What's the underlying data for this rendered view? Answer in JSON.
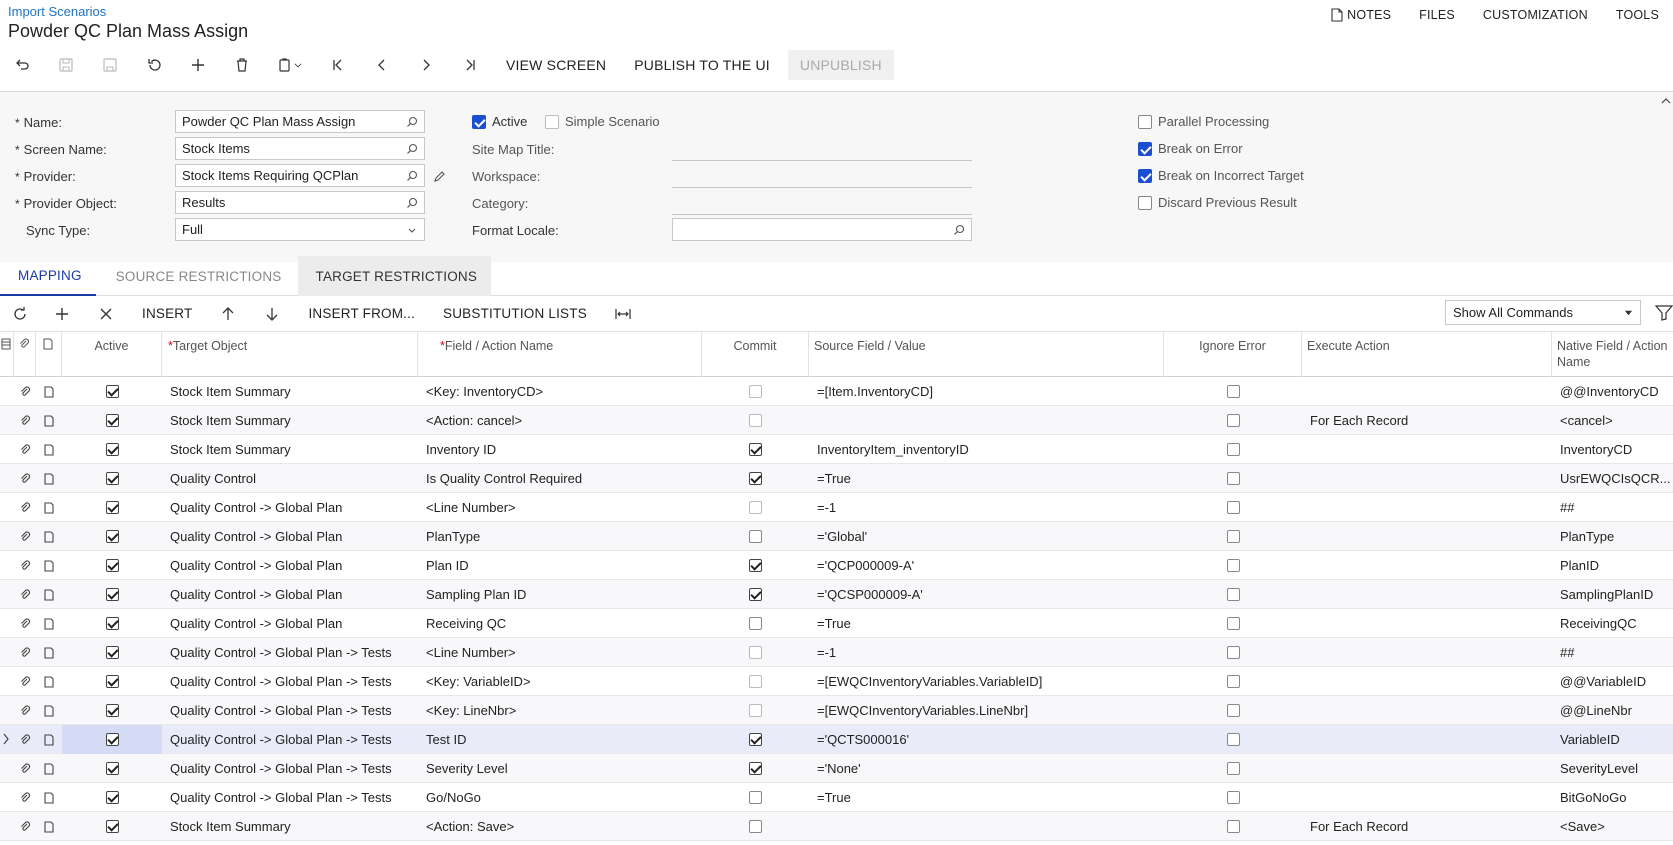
{
  "breadcrumb": "Import Scenarios",
  "title": "Powder QC Plan Mass Assign",
  "top_links": [
    {
      "label": "NOTES",
      "icon": "note-icon"
    },
    {
      "label": "FILES"
    },
    {
      "label": "CUSTOMIZATION"
    },
    {
      "label": "TOOLS"
    }
  ],
  "toolbar": {
    "view_screen": "VIEW SCREEN",
    "publish": "PUBLISH TO THE UI",
    "unpublish": "UNPUBLISH"
  },
  "form": {
    "name_label": "Name:",
    "name_value": "Powder QC Plan Mass Assign",
    "screen_label": "Screen Name:",
    "screen_value": "Stock Items",
    "provider_label": "Provider:",
    "provider_value": "Stock Items Requiring QCPlan",
    "provider_object_label": "Provider Object:",
    "provider_object_value": "Results",
    "sync_label": "Sync Type:",
    "sync_value": "Full",
    "active_label": "Active",
    "active": true,
    "simple_label": "Simple Scenario",
    "simple": false,
    "sitemap_label": "Site Map Title:",
    "workspace_label": "Workspace:",
    "category_label": "Category:",
    "format_locale_label": "Format Locale:",
    "parallel_label": "Parallel Processing",
    "parallel": false,
    "break_error_label": "Break on Error",
    "break_error": true,
    "break_target_label": "Break on Incorrect Target",
    "break_target": true,
    "discard_label": "Discard Previous Result",
    "discard": false
  },
  "tabs": [
    "MAPPING",
    "SOURCE RESTRICTIONS",
    "TARGET RESTRICTIONS"
  ],
  "grid_toolbar": {
    "insert": "INSERT",
    "insert_from": "INSERT FROM...",
    "substitution_lists": "SUBSTITUTION LISTS",
    "command_filter": "Show All Commands"
  },
  "columns": {
    "active": "Active",
    "target_object": "Target Object",
    "field_action": "Field / Action Name",
    "commit": "Commit",
    "source": "Source Field / Value",
    "ignore_error": "Ignore Error",
    "execute_action": "Execute Action",
    "native_field": "Native Field / Action Name"
  },
  "rows": [
    {
      "active": true,
      "target": "Stock Item Summary",
      "field": "<Key: InventoryCD>",
      "commit": false,
      "commit_dim": true,
      "source": "=[Item.InventoryCD]",
      "ignore": false,
      "exec": "",
      "native": "@@InventoryCD"
    },
    {
      "active": true,
      "target": "Stock Item Summary",
      "field": "<Action: cancel>",
      "commit": false,
      "commit_dim": true,
      "source": "",
      "ignore": false,
      "exec": "For Each Record",
      "native": "<cancel>"
    },
    {
      "active": true,
      "target": "Stock Item Summary",
      "field": "Inventory ID",
      "commit": true,
      "commit_dim": false,
      "source": "InventoryItem_inventoryID",
      "ignore": false,
      "exec": "",
      "native": "InventoryCD"
    },
    {
      "active": true,
      "target": "Quality Control",
      "field": "Is Quality Control Required",
      "commit": true,
      "commit_dim": false,
      "source": "=True",
      "ignore": false,
      "exec": "",
      "native": "UsrEWQCIsQCR..."
    },
    {
      "active": true,
      "target": "Quality Control -> Global Plan",
      "field": "<Line Number>",
      "commit": false,
      "commit_dim": true,
      "source": "=-1",
      "ignore": false,
      "exec": "",
      "native": "##"
    },
    {
      "active": true,
      "target": "Quality Control -> Global Plan",
      "field": "PlanType",
      "commit": false,
      "commit_dim": false,
      "source": "='Global'",
      "ignore": false,
      "exec": "",
      "native": "PlanType"
    },
    {
      "active": true,
      "target": "Quality Control -> Global Plan",
      "field": "Plan ID",
      "commit": true,
      "commit_dim": false,
      "source": "='QCP000009-A'",
      "ignore": false,
      "exec": "",
      "native": "PlanID"
    },
    {
      "active": true,
      "target": "Quality Control -> Global Plan",
      "field": "Sampling Plan ID",
      "commit": true,
      "commit_dim": false,
      "source": "='QCSP000009-A'",
      "ignore": false,
      "exec": "",
      "native": "SamplingPlanID"
    },
    {
      "active": true,
      "target": "Quality Control -> Global Plan",
      "field": "Receiving QC",
      "commit": false,
      "commit_dim": false,
      "source": "=True",
      "ignore": false,
      "exec": "",
      "native": "ReceivingQC"
    },
    {
      "active": true,
      "target": "Quality Control -> Global Plan -> Tests",
      "field": "<Line Number>",
      "commit": false,
      "commit_dim": true,
      "source": "=-1",
      "ignore": false,
      "exec": "",
      "native": "##"
    },
    {
      "active": true,
      "target": "Quality Control -> Global Plan -> Tests",
      "field": "<Key: VariableID>",
      "commit": false,
      "commit_dim": true,
      "source": "=[EWQCInventoryVariables.VariableID]",
      "ignore": false,
      "exec": "",
      "native": "@@VariableID"
    },
    {
      "active": true,
      "target": "Quality Control -> Global Plan -> Tests",
      "field": "<Key: LineNbr>",
      "commit": false,
      "commit_dim": true,
      "source": "=[EWQCInventoryVariables.LineNbr]",
      "ignore": false,
      "exec": "",
      "native": "@@LineNbr"
    },
    {
      "active": true,
      "target": "Quality Control -> Global Plan -> Tests",
      "field": "Test ID",
      "commit": true,
      "commit_dim": false,
      "source": "='QCTS000016'",
      "ignore": false,
      "exec": "",
      "native": "VariableID",
      "selected": true
    },
    {
      "active": true,
      "target": "Quality Control -> Global Plan -> Tests",
      "field": "Severity Level",
      "commit": true,
      "commit_dim": false,
      "source": "='None'",
      "ignore": false,
      "exec": "",
      "native": "SeverityLevel"
    },
    {
      "active": true,
      "target": "Quality Control -> Global Plan -> Tests",
      "field": "Go/NoGo",
      "commit": false,
      "commit_dim": false,
      "source": "=True",
      "ignore": false,
      "exec": "",
      "native": "BitGoNoGo"
    },
    {
      "active": true,
      "target": "Stock Item Summary",
      "field": "<Action: Save>",
      "commit": false,
      "commit_dim": false,
      "source": "",
      "ignore": false,
      "exec": "For Each Record",
      "native": "<Save>"
    }
  ],
  "colors": {
    "accent": "#1a3aa8",
    "link": "#1f74c3",
    "checkbox": "#1a4fcf",
    "selected_row": "#e9ebf8"
  }
}
